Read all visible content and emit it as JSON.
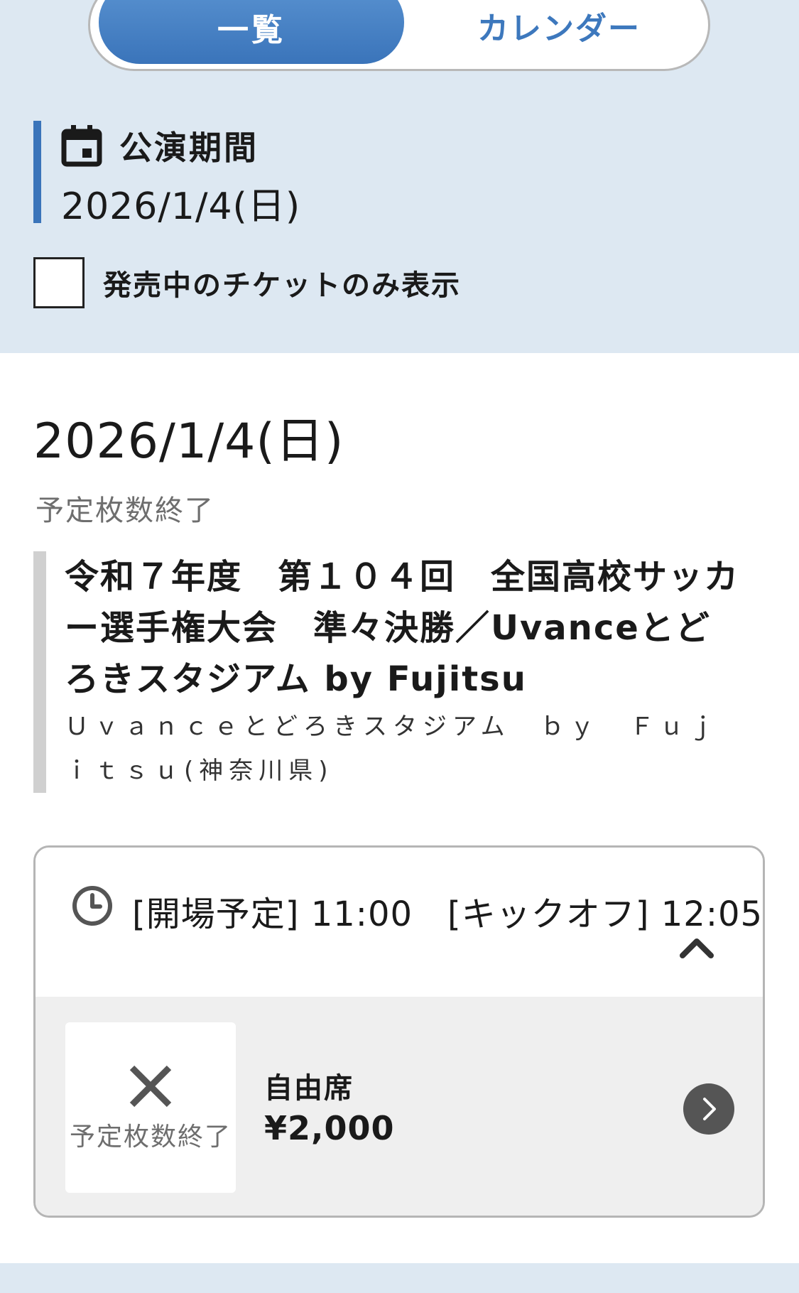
{
  "view_toggle": {
    "list_label": "一覧",
    "calendar_label": "カレンダー"
  },
  "period": {
    "title": "公演期間",
    "date": "2026/1/4(日)",
    "icon": "calendar-icon"
  },
  "filter": {
    "label": "発売中のチケットのみ表示",
    "checked": false
  },
  "listing": {
    "date_heading": "2026/1/4(日)",
    "status_note": "予定枚数終了",
    "event": {
      "title": "令和７年度　第１０４回　全国高校サッカー選手権大会　準々決勝／Uvanceとどろきスタジアム by Fujitsu",
      "venue": "Ｕｖａｎｃｅとどろきスタジアム　ｂｙ　Ｆｕｊｉｔｓｕ(神奈川県)"
    },
    "schedule": {
      "time_text": "[開場予定] 11:00　[キックオフ] 12:05",
      "clock_icon": "clock-icon",
      "collapse_icon": "chevron-up-icon",
      "tickets": [
        {
          "status_icon": "x-icon",
          "status_label": "予定枚数終了",
          "seat": "自由席",
          "price": "¥2,000",
          "action_icon": "chevron-right-icon"
        }
      ]
    }
  },
  "colors": {
    "accent": "#3a74ba",
    "panel_bg": "#dde8f2",
    "muted_text": "#6e6e6e"
  }
}
